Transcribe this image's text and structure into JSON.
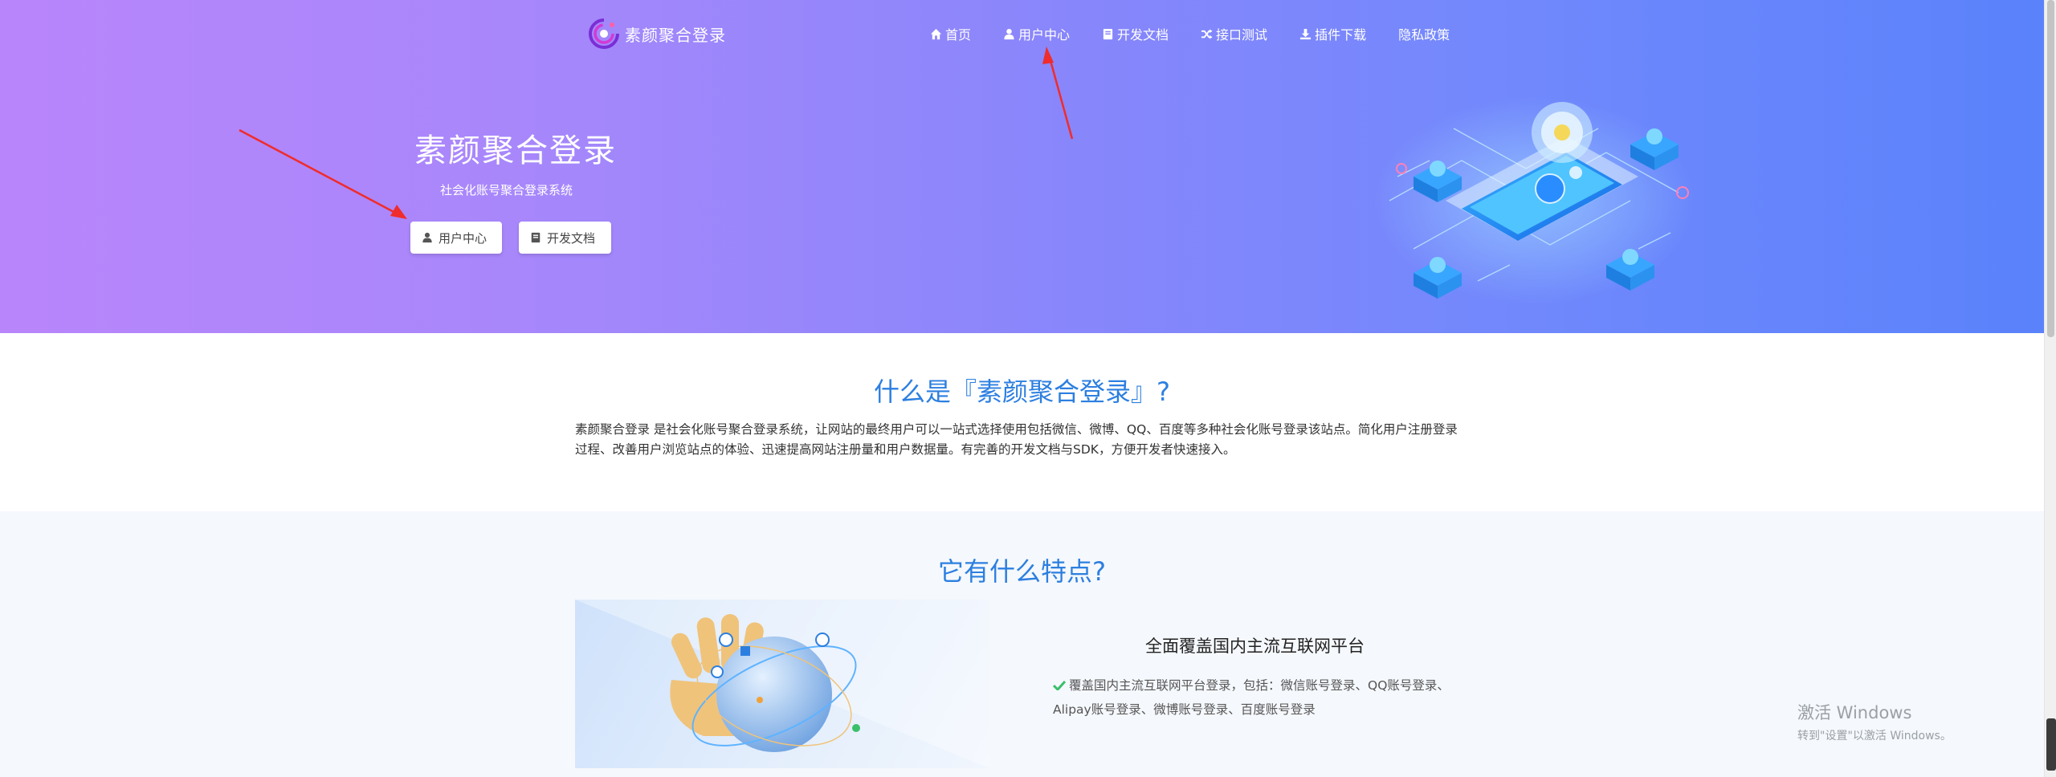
{
  "brand": {
    "name": "素颜聚合登录",
    "logo_icon": "swirl-logo-icon"
  },
  "nav": {
    "items": [
      {
        "label": "首页",
        "icon": "home-icon"
      },
      {
        "label": "用户中心",
        "icon": "user-icon"
      },
      {
        "label": "开发文档",
        "icon": "book-icon"
      },
      {
        "label": "接口测试",
        "icon": "shuffle-icon"
      },
      {
        "label": "插件下载",
        "icon": "download-icon"
      },
      {
        "label": "隐私政策",
        "icon": ""
      }
    ]
  },
  "hero": {
    "title": "素颜聚合登录",
    "subtitle": "社会化账号聚合登录系统",
    "buttons": [
      {
        "label": "用户中心",
        "icon": "user-icon"
      },
      {
        "label": "开发文档",
        "icon": "book-icon"
      }
    ]
  },
  "about": {
    "title": "什么是『素颜聚合登录』?",
    "description": "素颜聚合登录 是社会化账号聚合登录系统，让网站的最终用户可以一站式选择使用包括微信、微博、QQ、百度等多种社会化账号登录该站点。简化用户注册登录过程、改善用户浏览站点的体验、迅速提高网站注册量和用户数据量。有完善的开发文档与SDK，方便开发者快速接入。"
  },
  "features": {
    "title": "它有什么特点?",
    "items": [
      {
        "heading": "全面覆盖国内主流互联网平台",
        "text": "覆盖国内主流互联网平台登录，包括：微信账号登录、QQ账号登录、Alipay账号登录、微博账号登录、百度账号登录"
      }
    ]
  },
  "watermark": {
    "line1": "激活 Windows",
    "line2": "转到\"设置\"以激活 Windows。"
  },
  "colors": {
    "accent": "#2c7fe0",
    "hero_start": "#b985fb",
    "hero_end": "#5a82fb",
    "annotation": "#f02c2c"
  }
}
